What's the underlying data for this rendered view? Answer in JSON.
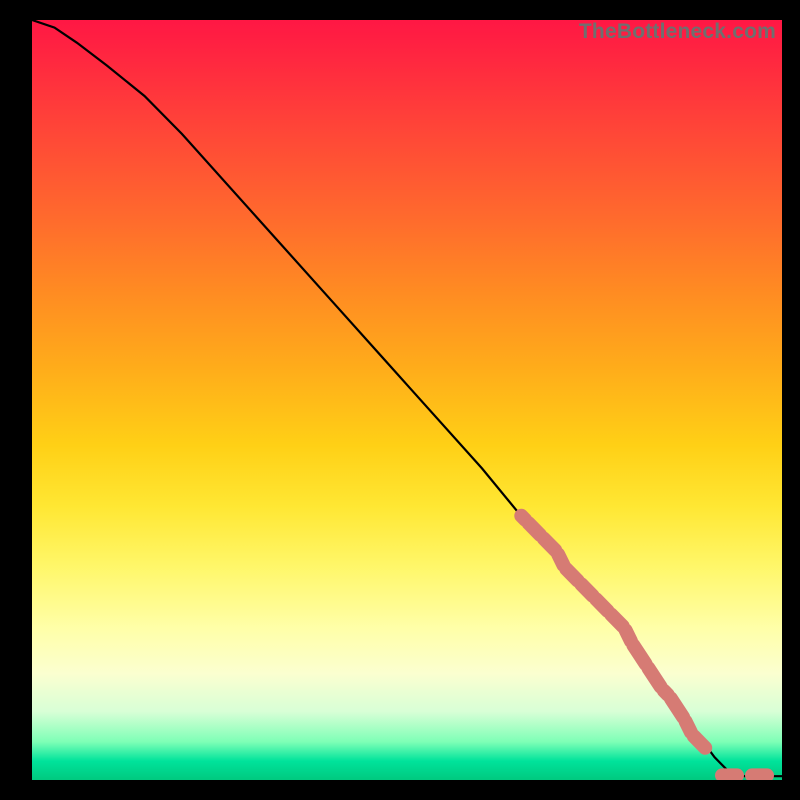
{
  "watermark": "TheBottleneck.com",
  "chart_data": {
    "type": "line",
    "title": "",
    "xlabel": "",
    "ylabel": "",
    "xlim": [
      0,
      100
    ],
    "ylim": [
      0,
      100
    ],
    "grid": false,
    "series": [
      {
        "name": "curve",
        "style": "solid-black",
        "x": [
          0,
          3,
          6,
          10,
          15,
          20,
          30,
          40,
          50,
          60,
          65,
          70,
          75,
          80,
          82,
          85,
          88,
          91,
          93,
          95,
          97,
          99,
          100
        ],
        "y": [
          100,
          99,
          97,
          94,
          90,
          85,
          74,
          63,
          52,
          41,
          35,
          30,
          24,
          18,
          15,
          11,
          7,
          3,
          1,
          0.5,
          0.5,
          0.5,
          0.5
        ]
      },
      {
        "name": "highlight-diagonal",
        "style": "thick-salmon-dashed",
        "color": "#d67b74",
        "x": [
          65,
          66,
          68,
          70,
          71,
          73,
          75,
          77,
          79,
          80,
          82,
          84,
          85,
          87,
          88,
          90
        ],
        "y": [
          35,
          34,
          32,
          30,
          28,
          26,
          24,
          22,
          20,
          18,
          15,
          12,
          11,
          8,
          6,
          4
        ]
      },
      {
        "name": "highlight-flat",
        "style": "thick-salmon-dashed",
        "color": "#d67b74",
        "x": [
          92,
          94,
          96,
          98,
          100
        ],
        "y": [
          0.6,
          0.6,
          0.6,
          0.6,
          0.6
        ]
      }
    ]
  }
}
